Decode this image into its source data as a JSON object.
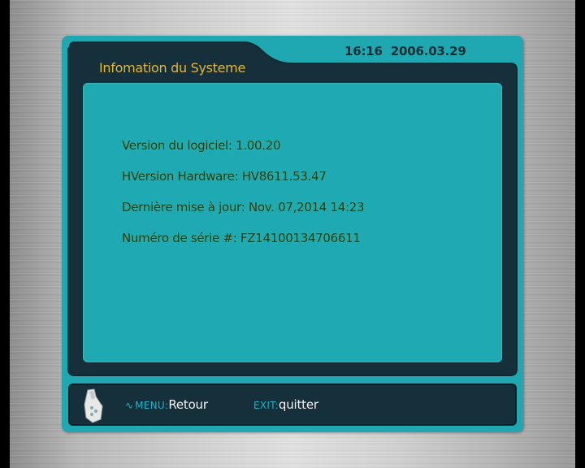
{
  "screen": {
    "title": "Infomation du Systeme",
    "clock": {
      "time": "16:16",
      "date": "2006.03.29"
    }
  },
  "info": {
    "lines": [
      "Version du logiciel: 1.00.20",
      "HVersion Hardware: HV8611.53.47",
      "Dernière mise à jour: Nov. 07,2014 14:23",
      "Numéro de série #: FZ14100134706611"
    ]
  },
  "footer": {
    "menu_key": "MENU:",
    "menu_action": "Retour",
    "exit_key": "EXIT:",
    "exit_action": "quitter",
    "remote_icon": "remote-control-in-hand-icon",
    "menu_glyph": "wave-icon"
  },
  "colors": {
    "panel_teal": "#1fa7b2",
    "frame_dark": "#15303a",
    "title_gold": "#e3b63a",
    "info_text": "#1b3a14",
    "key_cyan": "#1fb2c8"
  }
}
